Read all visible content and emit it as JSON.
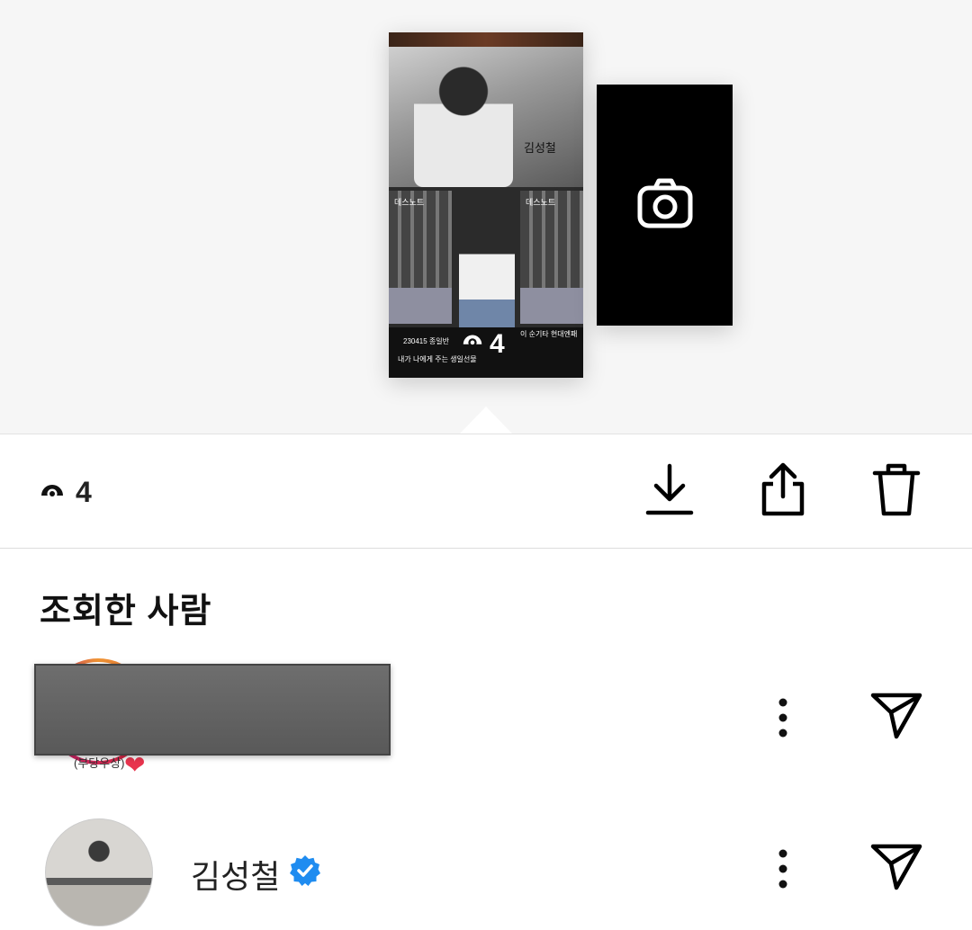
{
  "story_preview": {
    "poster_name": "김성철",
    "left_panel_title": "데스노트",
    "right_panel_title": "데스노트",
    "caption_date": "230415 종일반",
    "caption_line": "내가 나에게 주는 생일선물",
    "caption_right": "이 순기타 현대엔패",
    "overlay_count": "4",
    "camera_icon": "camera-icon"
  },
  "toolbar": {
    "views_count": "4",
    "view_icon": "eye-icon",
    "download_icon": "download-icon",
    "share_icon": "share-icon",
    "delete_icon": "trash-icon"
  },
  "viewers": {
    "title": "조회한 사람",
    "items": [
      {
        "username": "",
        "redacted": true,
        "sticker_text": "(부당우상)",
        "has_story_ring": true,
        "more_icon": "more-vertical-icon",
        "send_icon": "send-icon"
      },
      {
        "username": "김성철",
        "verified": true,
        "has_story_ring": false,
        "more_icon": "more-vertical-icon",
        "send_icon": "send-icon"
      }
    ]
  },
  "colors": {
    "preview_bg": "#f6f6f6",
    "verified_blue": "#1f8cf0",
    "icon_black": "#000000"
  }
}
